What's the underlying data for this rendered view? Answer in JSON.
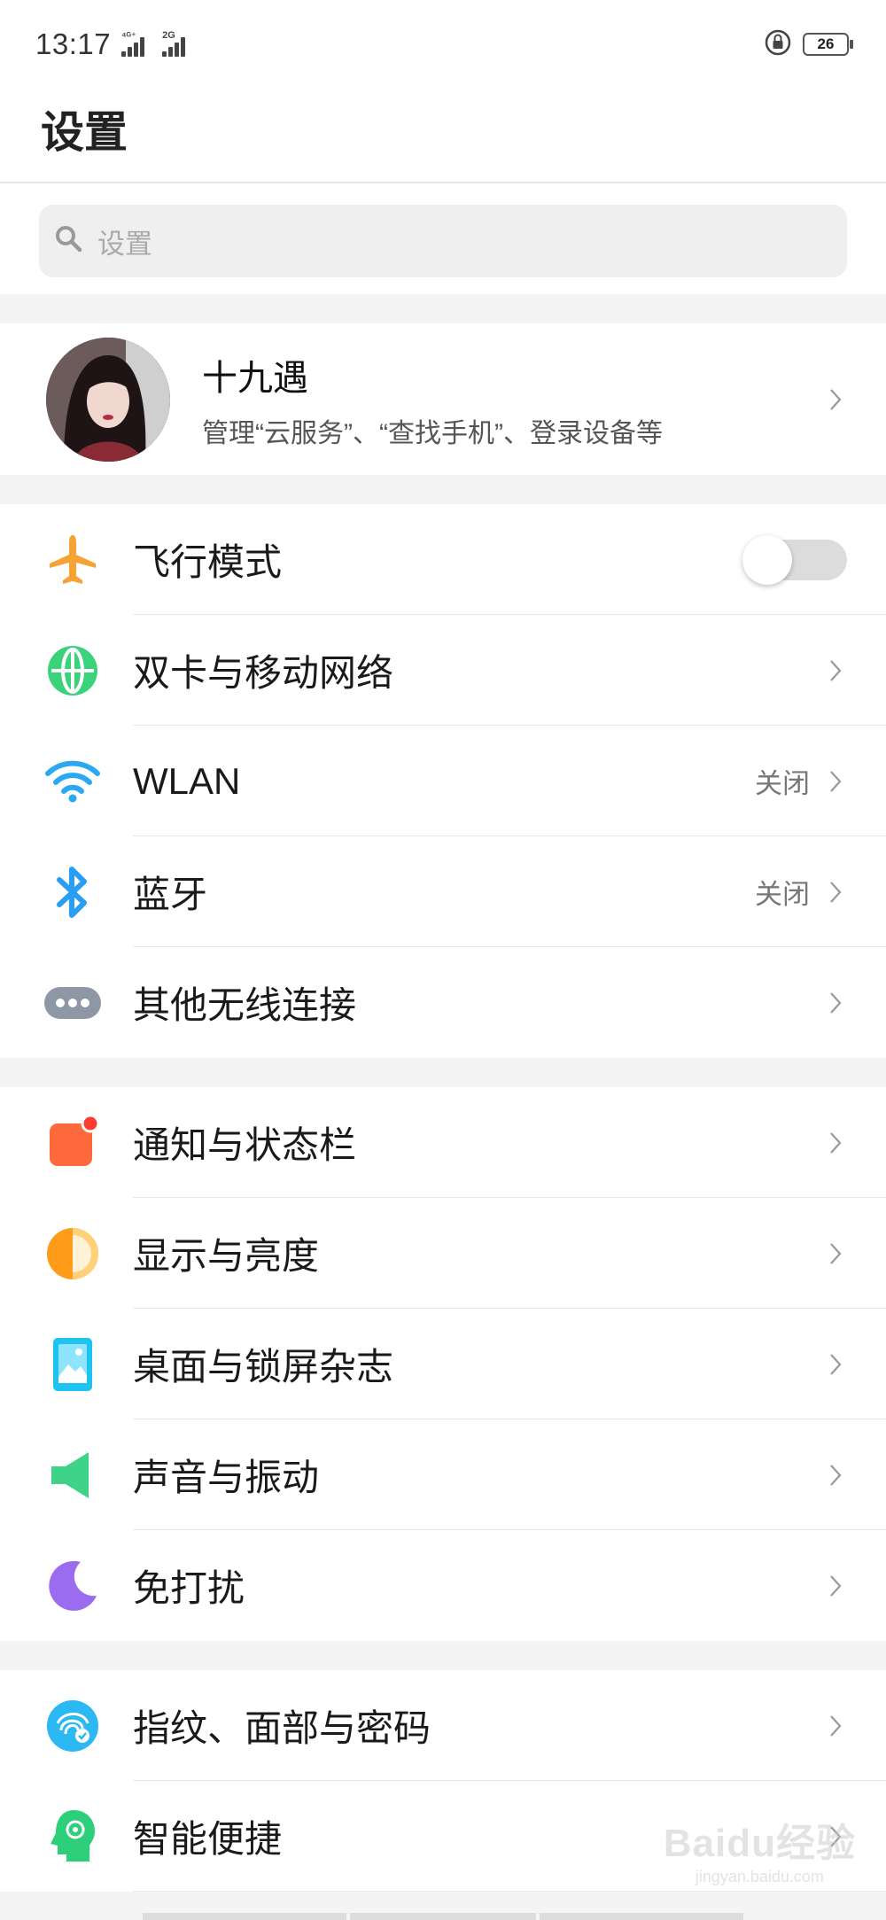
{
  "status_bar": {
    "time": "13:17",
    "signal1_tag": "⁴ᴳ⁺",
    "signal2_tag": "2G",
    "battery": "26"
  },
  "page_title": "设置",
  "search": {
    "placeholder": "设置"
  },
  "account": {
    "name": "十九遇",
    "subtitle": "管理“云服务”、“查找手机”、登录设备等"
  },
  "groups": [
    {
      "rows": [
        {
          "label": "飞行模式",
          "icon": "airplane-icon",
          "control": "toggle",
          "toggle_on": false
        },
        {
          "label": "双卡与移动网络",
          "icon": "globe-icon"
        },
        {
          "label": "WLAN",
          "icon": "wifi-icon",
          "value": "关闭"
        },
        {
          "label": "蓝牙",
          "icon": "bluetooth-icon",
          "value": "关闭"
        },
        {
          "label": "其他无线连接",
          "icon": "more-dots-icon"
        }
      ]
    },
    {
      "rows": [
        {
          "label": "通知与状态栏",
          "icon": "notification-icon"
        },
        {
          "label": "显示与亮度",
          "icon": "brightness-icon"
        },
        {
          "label": "桌面与锁屏杂志",
          "icon": "wallpaper-icon"
        },
        {
          "label": "声音与振动",
          "icon": "speaker-icon"
        },
        {
          "label": "免打扰",
          "icon": "moon-icon"
        }
      ]
    },
    {
      "rows": [
        {
          "label": "指纹、面部与密码",
          "icon": "fingerprint-icon"
        },
        {
          "label": "智能便捷",
          "icon": "smart-assist-icon"
        }
      ]
    }
  ],
  "watermark": {
    "brand": "Baidu经验",
    "url": "jingyan.baidu.com"
  },
  "colors": {
    "airplane": "#f7a234",
    "globe": "#3ad27a",
    "wifi": "#2aa8f2",
    "bluetooth": "#2a9df4",
    "more": "#8e97a6",
    "notification": "#ff6a3d",
    "brightness": "#ff9c1a",
    "wallpaper": "#1fc3ef",
    "speaker": "#3fd38a",
    "moon": "#9b6cf0",
    "fingerprint": "#2bb8f3",
    "smart": "#2ecf7a"
  }
}
